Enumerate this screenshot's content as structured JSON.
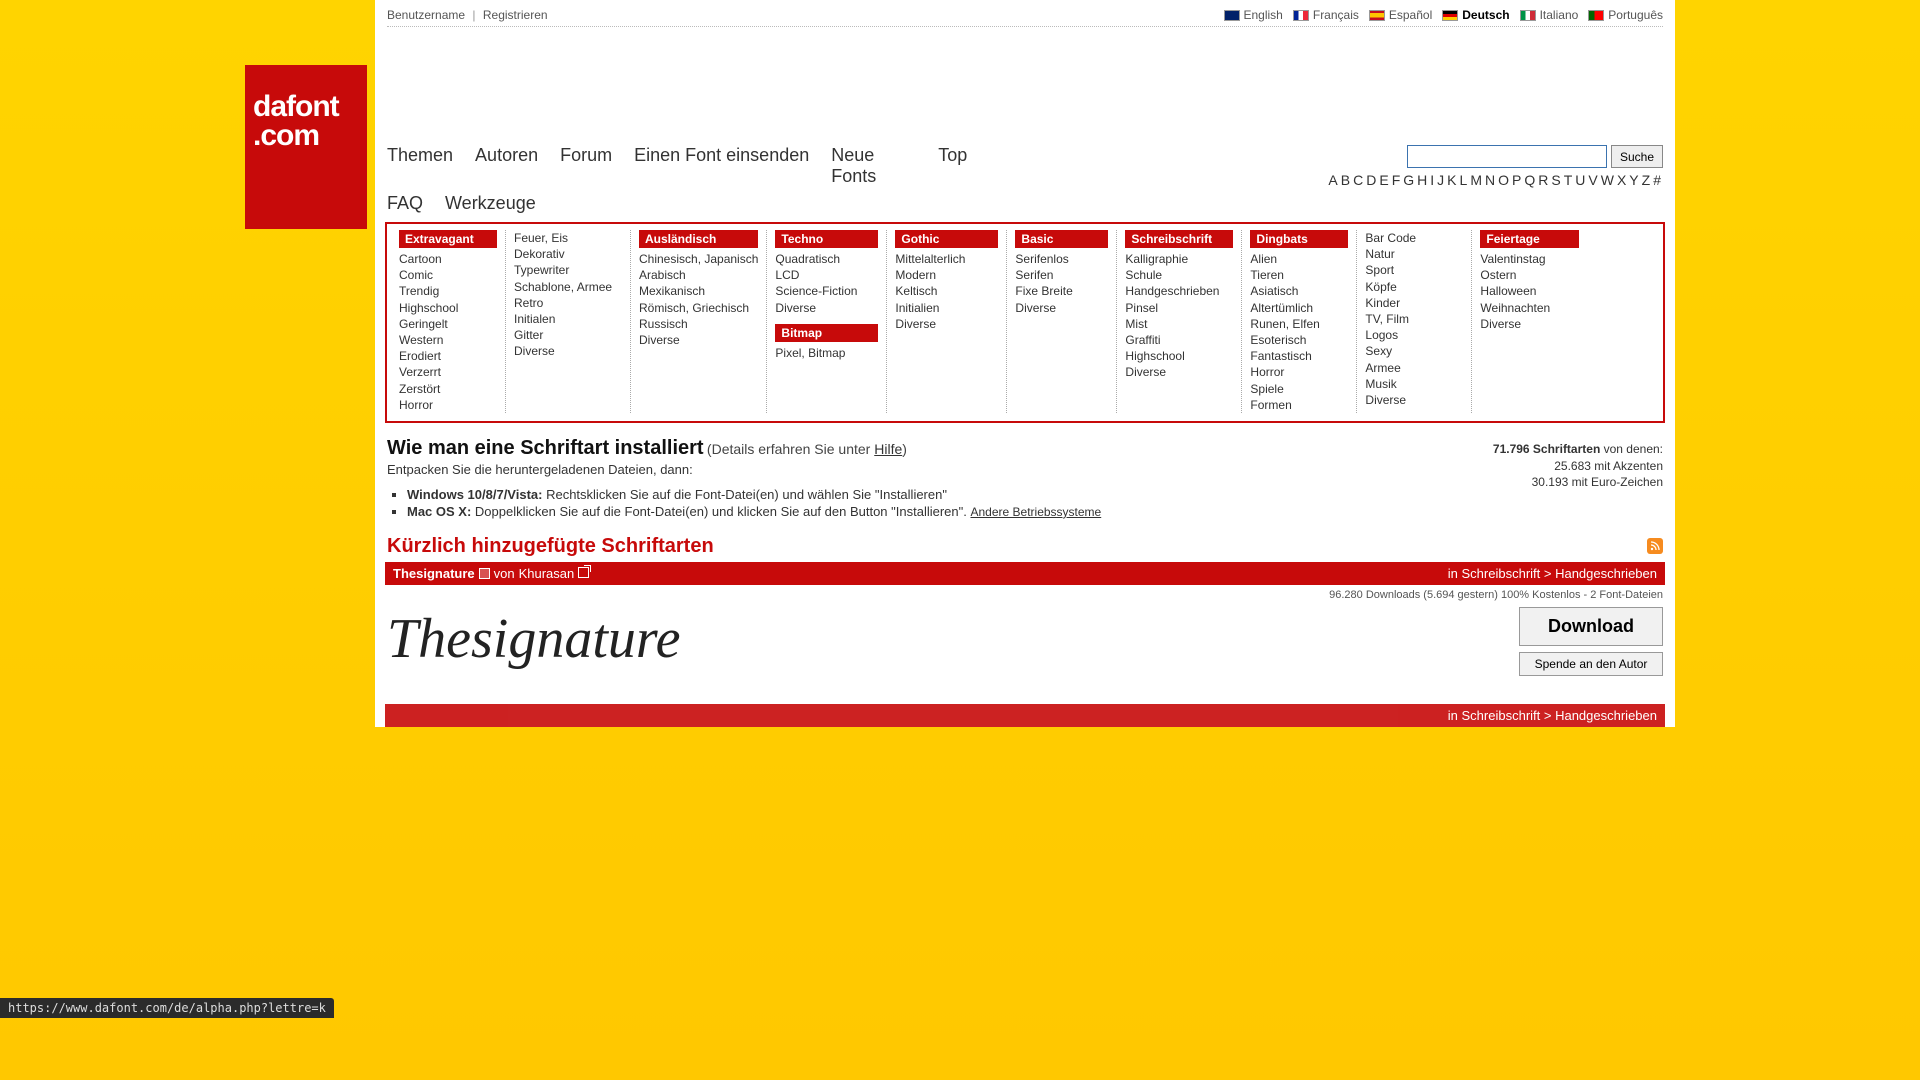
{
  "logo": {
    "line1": "dafont",
    "line2": ".com"
  },
  "topbar": {
    "username": "Benutzername",
    "register": "Registrieren"
  },
  "languages": [
    {
      "code": "en",
      "label": "English",
      "flag": "flag-en"
    },
    {
      "code": "fr",
      "label": "Français",
      "flag": "flag-fr"
    },
    {
      "code": "es",
      "label": "Español",
      "flag": "flag-es"
    },
    {
      "code": "de",
      "label": "Deutsch",
      "flag": "flag-de",
      "active": true
    },
    {
      "code": "it",
      "label": "Italiano",
      "flag": "flag-it"
    },
    {
      "code": "pt",
      "label": "Português",
      "flag": "flag-pt"
    }
  ],
  "nav": {
    "themen": "Themen",
    "autoren": "Autoren",
    "forum": "Forum",
    "submit": "Einen Font einsenden",
    "neue": "Neue Fonts",
    "top": "Top",
    "faq": "FAQ",
    "werkzeuge": "Werkzeuge"
  },
  "search": {
    "button": "Suche",
    "placeholder": ""
  },
  "alphabet": [
    "A",
    "B",
    "C",
    "D",
    "E",
    "F",
    "G",
    "H",
    "I",
    "J",
    "K",
    "L",
    "M",
    "N",
    "O",
    "P",
    "Q",
    "R",
    "S",
    "T",
    "U",
    "V",
    "W",
    "X",
    "Y",
    "Z",
    "#"
  ],
  "categories": {
    "extravagant": {
      "title": "Extravagant",
      "items": [
        "Cartoon",
        "Comic",
        "Trendig",
        "Highschool",
        "Geringelt",
        "Western",
        "Erodiert",
        "Verzerrt",
        "Zerstört",
        "Horror"
      ]
    },
    "col2": {
      "items": [
        "Feuer, Eis",
        "Dekorativ",
        "Typewriter",
        "Schablone, Armee",
        "Retro",
        "Initialen",
        "Gitter",
        "Diverse"
      ]
    },
    "auslaendisch": {
      "title": "Ausländisch",
      "items": [
        "Chinesisch, Japanisch",
        "Arabisch",
        "Mexikanisch",
        "Römisch, Griechisch",
        "Russisch",
        "Diverse"
      ]
    },
    "techno": {
      "title": "Techno",
      "items": [
        "Quadratisch",
        "LCD",
        "Science-Fiction",
        "Diverse"
      ]
    },
    "bitmap": {
      "title": "Bitmap",
      "items": [
        "Pixel, Bitmap"
      ]
    },
    "gothic": {
      "title": "Gothic",
      "items": [
        "Mittelalterlich",
        "Modern",
        "Keltisch",
        "Initialien",
        "Diverse"
      ]
    },
    "basic": {
      "title": "Basic",
      "items": [
        "Serifenlos",
        "Serifen",
        "Fixe Breite",
        "Diverse"
      ]
    },
    "schreibschrift": {
      "title": "Schreibschrift",
      "items": [
        "Kalligraphie",
        "Schule",
        "Handgeschrieben",
        "Pinsel",
        "Mist",
        "Graffiti",
        "Highschool",
        "Diverse"
      ]
    },
    "dingbats": {
      "title": "Dingbats",
      "items": [
        "Alien",
        "Tieren",
        "Asiatisch",
        "Altertümlich",
        "Runen, Elfen",
        "Esoterisch",
        "Fantastisch",
        "Horror",
        "Spiele",
        "Formen"
      ]
    },
    "col9": {
      "items": [
        "Bar Code",
        "Natur",
        "Sport",
        "Köpfe",
        "Kinder",
        "TV, Film",
        "Logos",
        "Sexy",
        "Armee",
        "Musik",
        "Diverse"
      ]
    },
    "feiertage": {
      "title": "Feiertage",
      "items": [
        "Valentinstag",
        "Ostern",
        "Halloween",
        "Weihnachten",
        "Diverse"
      ]
    }
  },
  "install": {
    "heading": "Wie man eine Schriftart installiert",
    "details_pre": "(Details erfahren Sie unter ",
    "details_link": "Hilfe",
    "details_post": ")",
    "unpack": "Entpacken Sie die heruntergeladenen Dateien, dann:",
    "windows_b": "Windows 10/8/7/Vista:",
    "windows_t": " Rechtsklicken Sie auf die Font-Datei(en) und wählen Sie \"Installieren\"",
    "mac_b": "Mac OS X:",
    "mac_t": " Doppelklicken Sie auf die Font-Datei(en) und klicken Sie auf den Button \"Installieren\".   ",
    "other": "Andere Betriebssysteme"
  },
  "stats_panel": {
    "line1a": "71.796 Schriftarten",
    "line1b": " von denen:",
    "line2": "25.683 mit Akzenten",
    "line3": "30.193 mit Euro-Zeichen"
  },
  "recent": {
    "title": "Kürzlich hinzugefügte Schriftarten"
  },
  "font1": {
    "name": "Thesignature",
    "von": " von ",
    "author": "Khurasan",
    "cat_in": "in ",
    "cat_path": "Schreibschrift > Handgeschrieben",
    "stats": "96.280 Downloads (5.694 gestern)   100% Kostenlos - 2 Font-Dateien",
    "download": "Download",
    "donate": "Spende an den Autor",
    "preview_text": "Thesignature"
  },
  "status_url": "https://www.dafont.com/de/alpha.php?lettre=k"
}
